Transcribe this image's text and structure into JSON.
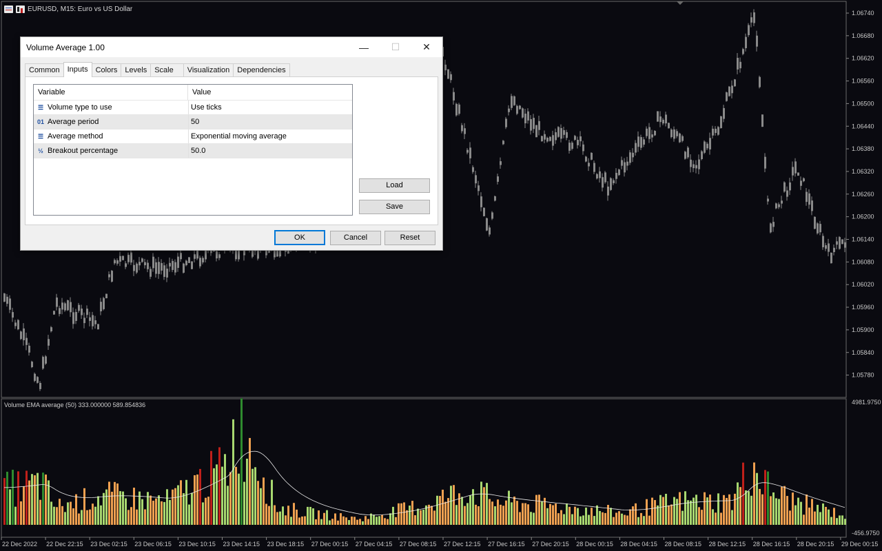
{
  "window": {
    "symbol_title": "EURUSD, M15:  Euro vs US Dollar",
    "subwindow_caption": "Volume EMA average (50) 333.000000 589.854836"
  },
  "price_axis": {
    "labels": [
      "1.06740",
      "1.06680",
      "1.06620",
      "1.06560",
      "1.06500",
      "1.06440",
      "1.06380",
      "1.06320",
      "1.06260",
      "1.06200",
      "1.06140",
      "1.06080",
      "1.06020",
      "1.05960",
      "1.05900",
      "1.05840",
      "1.05780"
    ]
  },
  "volume_axis": {
    "top": "4981.9750",
    "bottom": "-456.9750"
  },
  "time_axis": {
    "labels": [
      "22 Dec 2022",
      "22 Dec 22:15",
      "23 Dec 02:15",
      "23 Dec 06:15",
      "23 Dec 10:15",
      "23 Dec 14:15",
      "23 Dec 18:15",
      "27 Dec 00:15",
      "27 Dec 04:15",
      "27 Dec 08:15",
      "27 Dec 12:15",
      "27 Dec 16:15",
      "27 Dec 20:15",
      "28 Dec 00:15",
      "28 Dec 04:15",
      "28 Dec 08:15",
      "28 Dec 12:15",
      "28 Dec 16:15",
      "28 Dec 20:15",
      "29 Dec 00:15"
    ]
  },
  "colors": {
    "background": "#0a0a10",
    "candle": "#8a8a8a",
    "vol_up": "#2e8b2e",
    "vol_down": "#c0201a",
    "vol_light": "#a8d870",
    "vol_orange": "#f0a050",
    "average_line": "#e8e8e8"
  },
  "dialog": {
    "title": "Volume Average 1.00",
    "tabs": [
      "Common",
      "Inputs",
      "Colors",
      "Levels",
      "Scale",
      "Visualization",
      "Dependencies"
    ],
    "active_tab": "Inputs",
    "columns": {
      "variable": "Variable",
      "value": "Value"
    },
    "rows": [
      {
        "icon": "list-icon",
        "variable": "Volume type to use",
        "value": "Use ticks"
      },
      {
        "icon": "integer-icon",
        "variable": "Average period",
        "value": "50"
      },
      {
        "icon": "list-icon",
        "variable": "Average method",
        "value": "Exponential moving average"
      },
      {
        "icon": "fraction-icon",
        "variable": "Breakout percentage",
        "value": "50.0"
      }
    ],
    "row_icon_glyphs": {
      "list-icon": "☰",
      "integer-icon": "01",
      "fraction-icon": "½"
    },
    "buttons": {
      "load": "Load",
      "save": "Save",
      "ok": "OK",
      "cancel": "Cancel",
      "reset": "Reset"
    },
    "window_buttons": {
      "minimize": "—",
      "maximize": "☐",
      "close": "✕"
    }
  }
}
